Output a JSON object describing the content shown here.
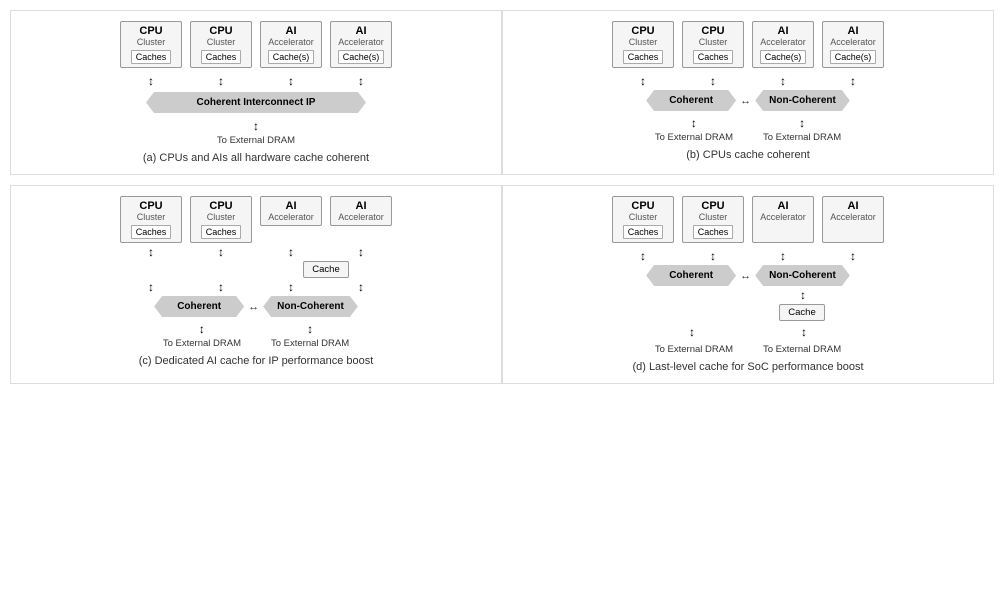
{
  "diagrams": [
    {
      "id": "a",
      "caption": "(a) CPUs and AIs all hardware cache coherent",
      "nodes": [
        {
          "title": "CPU",
          "subtitle": "Cluster",
          "cache": "Caches"
        },
        {
          "title": "CPU",
          "subtitle": "Cluster",
          "cache": "Caches"
        },
        {
          "title": "AI",
          "subtitle": "Accelerator",
          "cache": "Cache(s)"
        },
        {
          "title": "AI",
          "subtitle": "Accelerator",
          "cache": "Cache(s)"
        }
      ],
      "interconnect": "Coherent Interconnect IP",
      "dram": [
        "To External DRAM"
      ],
      "layout": "single-banner"
    },
    {
      "id": "b",
      "caption": "(b) CPUs cache coherent",
      "nodes": [
        {
          "title": "CPU",
          "subtitle": "Cluster",
          "cache": "Caches"
        },
        {
          "title": "CPU",
          "subtitle": "Cluster",
          "cache": "Caches"
        },
        {
          "title": "AI",
          "subtitle": "Accelerator",
          "cache": "Cache(s)"
        },
        {
          "title": "AI",
          "subtitle": "Accelerator",
          "cache": "Cache(s)"
        }
      ],
      "interconnect_left": "Coherent",
      "interconnect_right": "Non-Coherent",
      "dram": [
        "To External DRAM",
        "To External DRAM"
      ],
      "layout": "dual-banner"
    },
    {
      "id": "c",
      "caption": "(c) Dedicated AI cache for IP performance boost",
      "nodes": [
        {
          "title": "CPU",
          "subtitle": "Cluster",
          "cache": "Caches"
        },
        {
          "title": "CPU",
          "subtitle": "Cluster",
          "cache": "Caches"
        },
        {
          "title": "AI",
          "subtitle": "Accelerator",
          "cache": ""
        },
        {
          "title": "AI",
          "subtitle": "Accelerator",
          "cache": ""
        }
      ],
      "ai_cache_label": "Cache",
      "interconnect_left": "Coherent",
      "interconnect_right": "Non-Coherent",
      "dram": [
        "To External DRAM",
        "To External DRAM"
      ],
      "layout": "dual-banner-with-ai-cache"
    },
    {
      "id": "d",
      "caption": "(d) Last-level cache for SoC performance boost",
      "nodes": [
        {
          "title": "CPU",
          "subtitle": "Cluster",
          "cache": "Caches"
        },
        {
          "title": "CPU",
          "subtitle": "Cluster",
          "cache": "Caches"
        },
        {
          "title": "AI",
          "subtitle": "Accelerator",
          "cache": ""
        },
        {
          "title": "AI",
          "subtitle": "Accelerator",
          "cache": ""
        }
      ],
      "llc_label": "Cache",
      "interconnect_left": "Coherent",
      "interconnect_right": "Non-Coherent",
      "dram": [
        "To External DRAM",
        "To External DRAM"
      ],
      "layout": "dual-banner-with-llc"
    }
  ]
}
